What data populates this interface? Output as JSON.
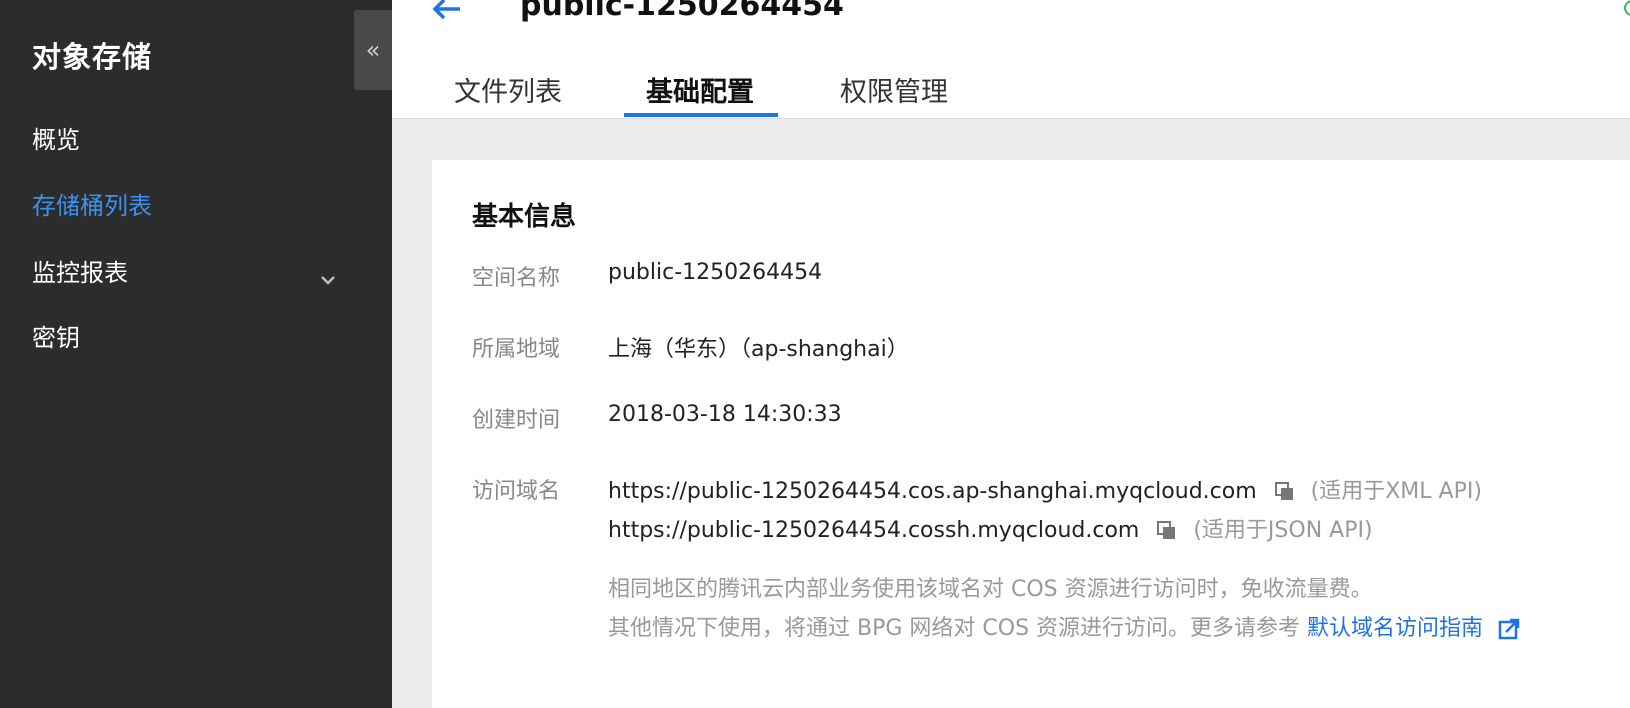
{
  "sidebar": {
    "title": "对象存储",
    "collapse_glyph": "«",
    "items": [
      {
        "label": "概览",
        "active": false
      },
      {
        "label": "存储桶列表",
        "active": true
      },
      {
        "label": "监控报表",
        "active": false,
        "has_chevron": true
      },
      {
        "label": "密钥",
        "active": false
      }
    ]
  },
  "header": {
    "bucket_name": "public-1250264454",
    "tabs": [
      {
        "label": "文件列表",
        "active": false
      },
      {
        "label": "基础配置",
        "active": true
      },
      {
        "label": "权限管理",
        "active": false
      }
    ]
  },
  "basic_info": {
    "title": "基本信息",
    "name_label": "空间名称",
    "name_value": "public-1250264454",
    "region_label": "所属地域",
    "region_value": "上海（华东）（ap-shanghai）",
    "created_label": "创建时间",
    "created_value": "2018-03-18 14:30:33",
    "domain_label": "访问域名",
    "domains": [
      {
        "url": "https://public-1250264454.cos.ap-shanghai.myqcloud.com",
        "note": "(适用于XML API)"
      },
      {
        "url": "https://public-1250264454.cossh.myqcloud.com",
        "note": "(适用于JSON API)"
      }
    ],
    "hint_line1": "相同地区的腾讯云内部业务使用该域名对 COS 资源进行访问时，免收流量费。",
    "hint_line2": "其他情况下使用，将通过 BPG 网络对 COS 资源进行访问。更多请参考",
    "hint_link": "默认域名访问指南"
  },
  "colors": {
    "sidebar_bg": "#2c2c2c",
    "accent": "#1f72e8",
    "active_nav": "#3d8ff0",
    "status": "#2fbd56"
  },
  "icons": [
    "collapse-sidebar-icon",
    "chevron-down-icon",
    "back-arrow-icon",
    "status-icon",
    "copy-icon",
    "external-link-icon"
  ]
}
